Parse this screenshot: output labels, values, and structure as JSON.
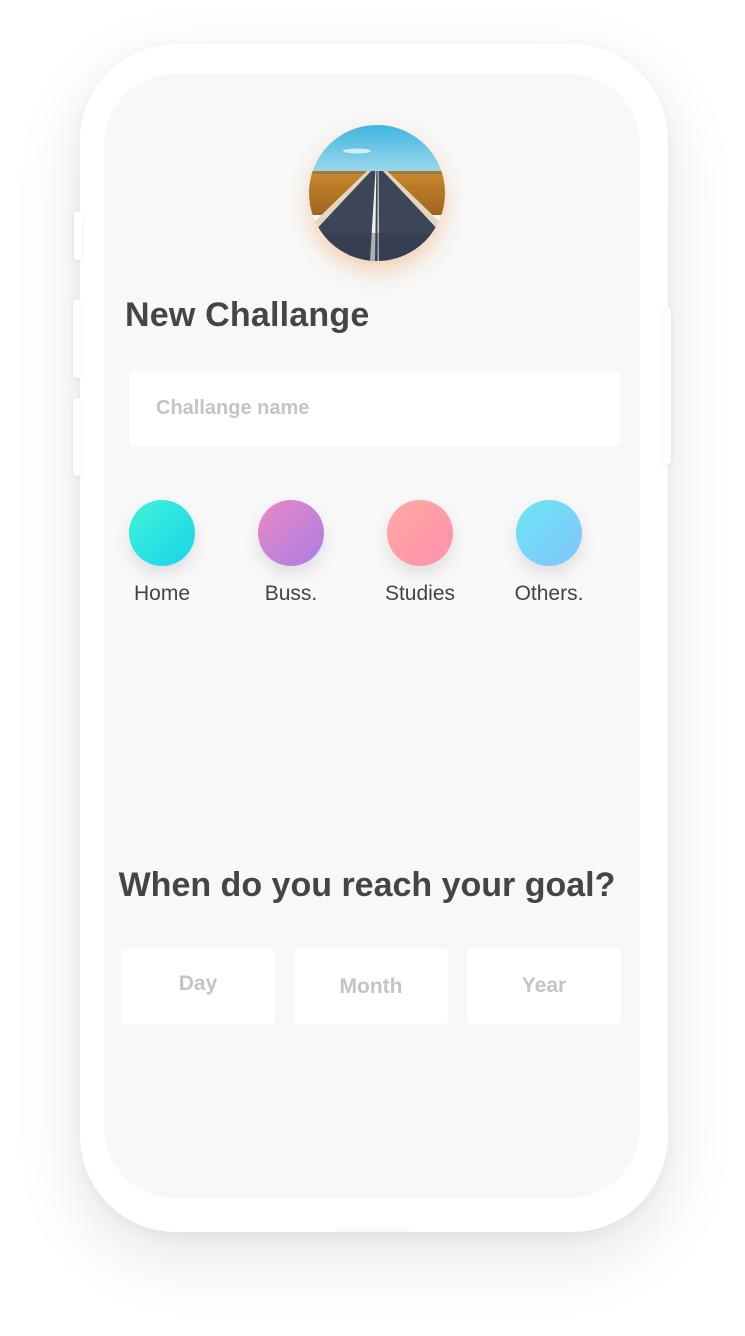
{
  "form": {
    "title": "New Challange",
    "name_placeholder": "Challange name",
    "name_value": ""
  },
  "categories": [
    {
      "label": "Home",
      "gradient_from": "#3ff3d6",
      "gradient_to": "#19d3ec"
    },
    {
      "label": "Buss.",
      "gradient_from": "#ec87c3",
      "gradient_to": "#a77fe5"
    },
    {
      "label": "Studies",
      "gradient_from": "#ffaaa1",
      "gradient_to": "#ff8fae"
    },
    {
      "label": "Others.",
      "gradient_from": "#6ce5f3",
      "gradient_to": "#82c5fb"
    }
  ],
  "goal": {
    "title": "When do you reach your goal?",
    "day_label": "Day",
    "month_label": "Month",
    "year_label": "Year"
  },
  "colors": {
    "screen_bg": "#f8f8f8",
    "text_dark": "#454545",
    "placeholder": "#c4c4c4"
  },
  "icons": {
    "avatar": "road-landscape-photo"
  }
}
